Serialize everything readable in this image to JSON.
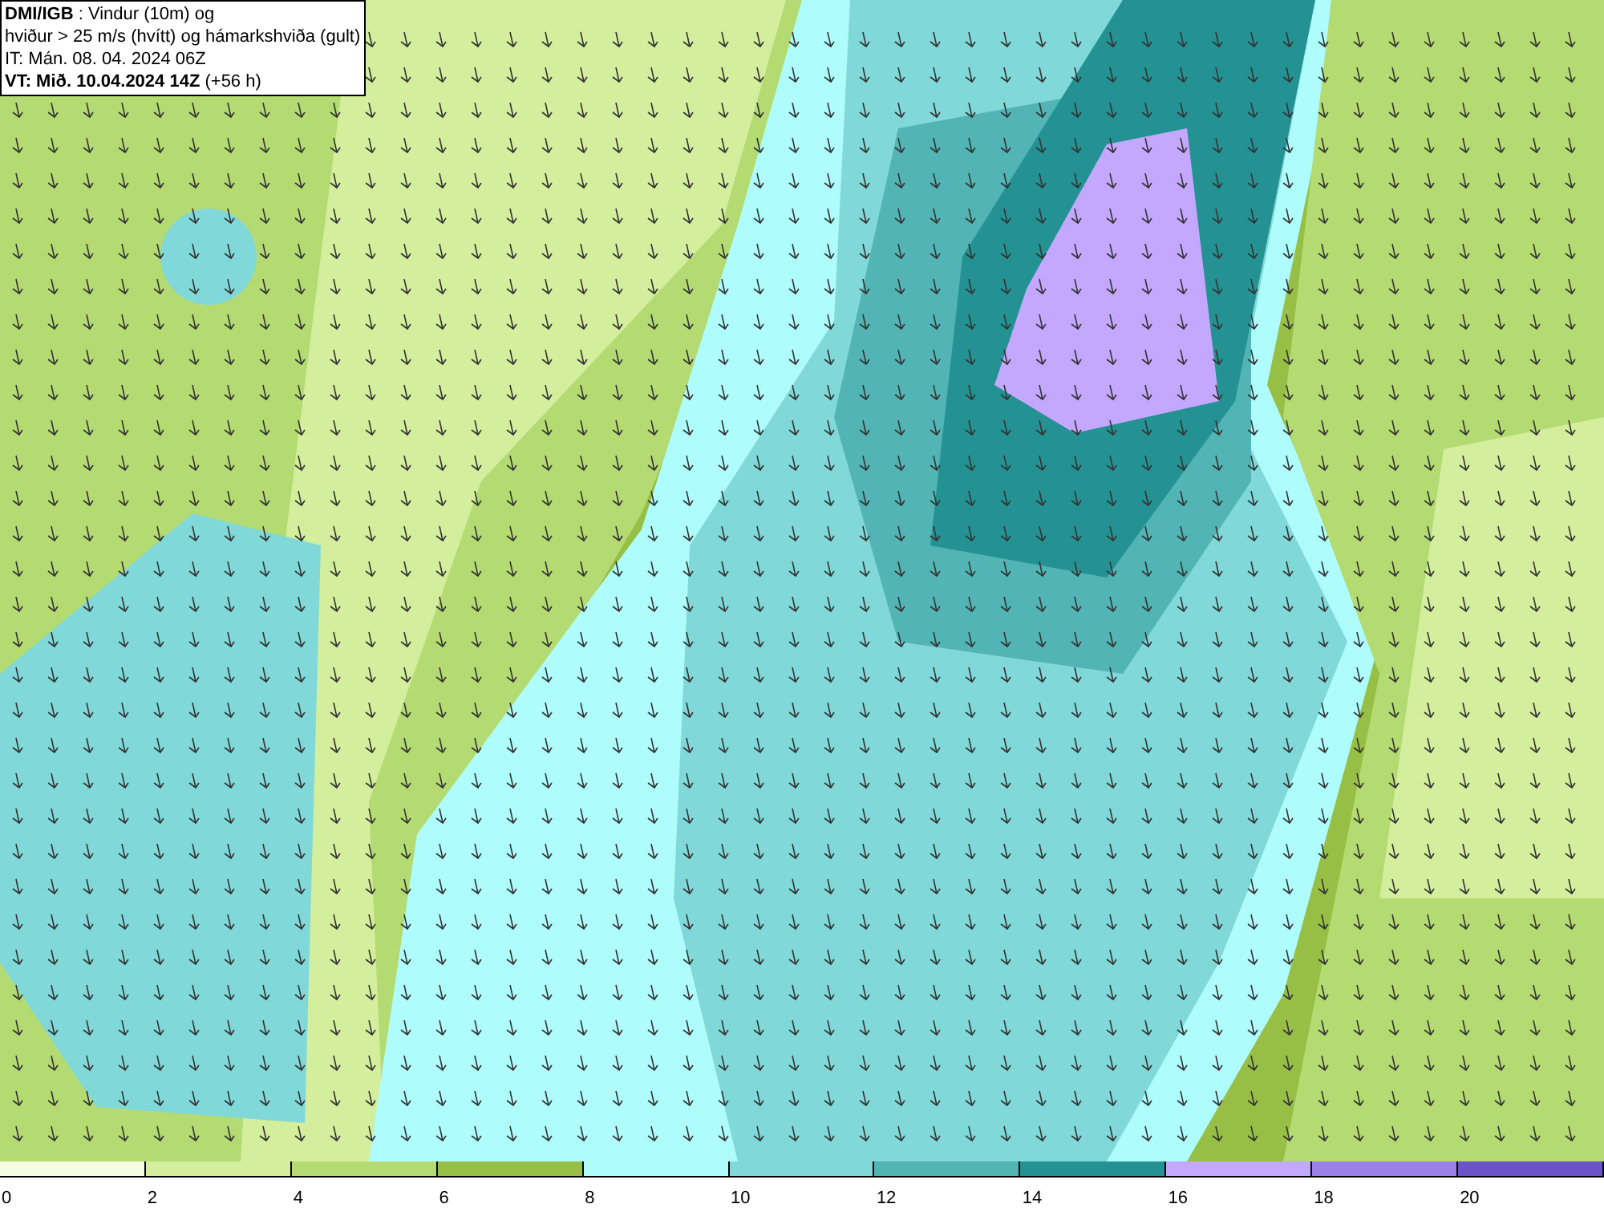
{
  "title_box": {
    "lines": [
      "**DMI/IGB** : Vindur (10m) og",
      "hviður > 25 m/s (hvítt) og hámarkshviða (gult)",
      "IT: Mán. 08. 04. 2024 06Z",
      "**VT: Mið. 10.04.2024 14Z** (+56 h)"
    ]
  },
  "legend": {
    "bins": [
      {
        "color": "#f4fbe0"
      },
      {
        "color": "#d3ee9c"
      },
      {
        "color": "#b4da72"
      },
      {
        "color": "#98bf45"
      },
      {
        "color": "#aefcfc"
      },
      {
        "color": "#80d8d8"
      },
      {
        "color": "#52b4b4"
      },
      {
        "color": "#249292"
      },
      {
        "color": "#c4a8ff"
      },
      {
        "color": "#9b80e8"
      },
      {
        "color": "#6c52c8"
      }
    ],
    "labels": [
      "0",
      "2",
      "4",
      "6",
      "8",
      "10",
      "12",
      "14",
      "16",
      "18",
      "20"
    ]
  }
}
